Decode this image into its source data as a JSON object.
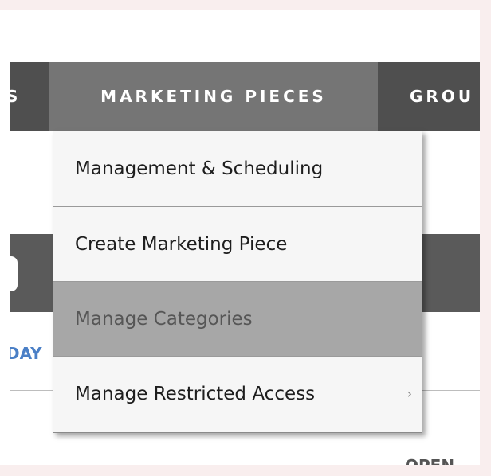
{
  "nav": {
    "prev_item": "S",
    "active_item": "MARKETING PIECES",
    "next_item": "GROU"
  },
  "background": {
    "day_link": "DAY",
    "open_label": "OPEN"
  },
  "dropdown": {
    "items": [
      {
        "label": "Management & Scheduling"
      },
      {
        "label": "Create Marketing Piece"
      },
      {
        "label": "Manage Categories"
      },
      {
        "label": "Manage Restricted Access",
        "submenu_icon": "chevron-right-icon",
        "submenu_glyph": "›"
      }
    ]
  }
}
